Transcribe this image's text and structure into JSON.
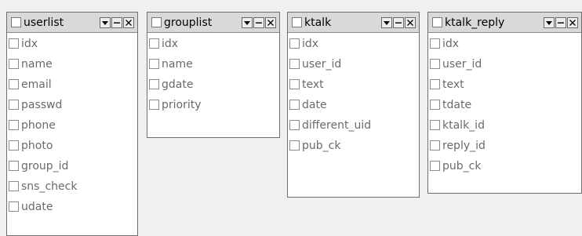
{
  "tables": [
    {
      "name": "userlist",
      "columns": [
        "idx",
        "name",
        "email",
        "passwd",
        "phone",
        "photo",
        "group_id",
        "sns_check",
        "udate"
      ]
    },
    {
      "name": "grouplist",
      "columns": [
        "idx",
        "name",
        "gdate",
        "priority"
      ]
    },
    {
      "name": "ktalk",
      "columns": [
        "idx",
        "user_id",
        "text",
        "date",
        "different_uid",
        "pub_ck"
      ]
    },
    {
      "name": "ktalk_reply",
      "columns": [
        "idx",
        "user_id",
        "text",
        "tdate",
        "ktalk_id",
        "reply_id",
        "pub_ck"
      ]
    }
  ],
  "controls": {
    "dropdown_icon": "dropdown-arrow-icon",
    "minimize_icon": "minimize-icon",
    "close_icon": "close-icon"
  }
}
